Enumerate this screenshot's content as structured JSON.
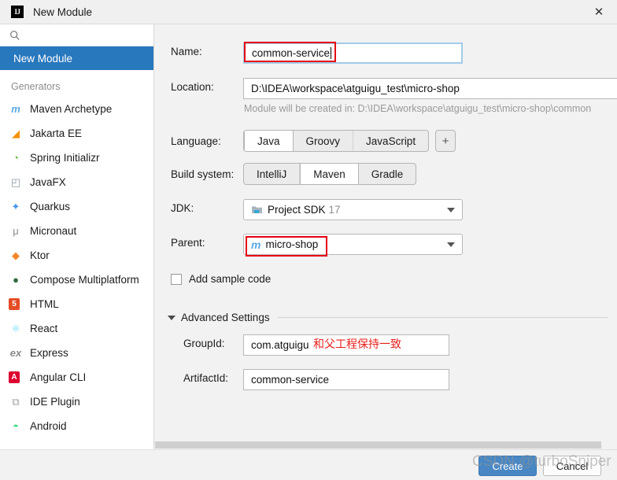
{
  "window": {
    "title": "New Module",
    "logo_text": "IJ",
    "close_label": "✕"
  },
  "sidebar": {
    "search_placeholder": "",
    "selected_item": "New Module",
    "generators_header": "Generators",
    "help_label": "?",
    "generators": [
      {
        "label": "Maven Archetype",
        "icon": "maven-icon",
        "glyph": "m",
        "color": "#5aa9e6"
      },
      {
        "label": "Jakarta EE",
        "icon": "jakarta-ee-icon",
        "glyph": "◢",
        "color": "#f39200"
      },
      {
        "label": "Spring Initializr",
        "icon": "spring-icon",
        "glyph": "◔",
        "color": "#6db33f"
      },
      {
        "label": "JavaFX",
        "icon": "javafx-icon",
        "glyph": "◰",
        "color": "#8a9aa8"
      },
      {
        "label": "Quarkus",
        "icon": "quarkus-icon",
        "glyph": "✦",
        "color": "#4695eb"
      },
      {
        "label": "Micronaut",
        "icon": "micronaut-icon",
        "glyph": "μ",
        "color": "#8c8c8c"
      },
      {
        "label": "Ktor",
        "icon": "ktor-icon",
        "glyph": "◆",
        "color": "#f4872b"
      },
      {
        "label": "Compose Multiplatform",
        "icon": "compose-icon",
        "glyph": "●",
        "color": "#2f6b3f"
      },
      {
        "label": "HTML",
        "icon": "html5-icon",
        "glyph": "5",
        "color": "#e44d26"
      },
      {
        "label": "React",
        "icon": "react-icon",
        "glyph": "⚛",
        "color": "#61dafb"
      },
      {
        "label": "Express",
        "icon": "express-icon",
        "glyph": "ex",
        "color": "#8a8a8a"
      },
      {
        "label": "Angular CLI",
        "icon": "angular-icon",
        "glyph": "A",
        "color": "#dd0031"
      },
      {
        "label": "IDE Plugin",
        "icon": "ide-plugin-icon",
        "glyph": "⧉",
        "color": "#9e9e9e"
      },
      {
        "label": "Android",
        "icon": "android-icon",
        "glyph": "◓",
        "color": "#3ddc84"
      }
    ]
  },
  "form": {
    "name_label": "Name:",
    "name_value": "common-service",
    "location_label": "Location:",
    "location_value": "D:\\IDEA\\workspace\\atguigu_test\\micro-shop",
    "location_hint": "Module will be created in: D:\\IDEA\\workspace\\atguigu_test\\micro-shop\\common",
    "language_label": "Language:",
    "language_options": [
      "Java",
      "Groovy",
      "JavaScript"
    ],
    "language_selected": "Java",
    "language_add_label": "+",
    "build_system_label": "Build system:",
    "build_system_options": [
      "IntelliJ",
      "Maven",
      "Gradle"
    ],
    "build_system_selected": "Maven",
    "jdk_label": "JDK:",
    "jdk_value": "Project SDK",
    "jdk_version": "17",
    "parent_label": "Parent:",
    "parent_value": "micro-shop",
    "parent_icon_glyph": "m",
    "sample_code_label": "Add sample code",
    "sample_code_checked": false,
    "advanced_label": "Advanced Settings",
    "group_id_label": "GroupId:",
    "group_id_value": "com.atguigu",
    "artifact_id_label": "ArtifactId:",
    "artifact_id_value": "common-service"
  },
  "annotations": {
    "group_id_note": "和父工程保持一致",
    "highlight_color": "#e60012",
    "note_color": "#e8201c"
  },
  "footer": {
    "create_label": "Create",
    "cancel_label": "Cancel"
  },
  "watermark": {
    "text": "CSDN @turboSniper"
  }
}
